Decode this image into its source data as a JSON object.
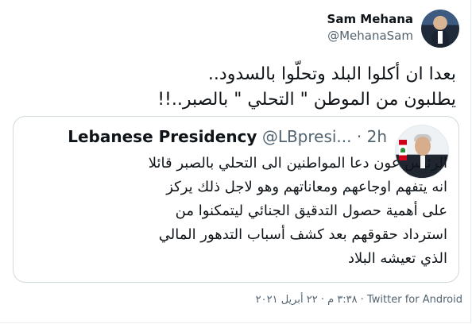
{
  "author": {
    "display_name": "Sam Mehana",
    "handle": "@MehanaSam"
  },
  "tweet": {
    "lines": [
      "بعدا ان أكلوا البلد وتحلّوا بالسدود..",
      "يطلبون من الموطن \" التحلي \" بالصبر..!!"
    ]
  },
  "quoted_tweet": {
    "display_name": "Lebanese Presidency",
    "handle": "@LBpresi...",
    "dot": "·",
    "time": "2h",
    "lines": [
      "الرئيس عون دعا المواطنين الى التحلي بالصبر قائلا",
      "انه يتفهم اوجاعهم ومعاناتهم وهو لاجل ذلك يركز",
      "على أهمية حصول التدقيق الجنائي ليتمكنوا من",
      "استرداد حقوقهم بعد كشف أسباب التدهور المالي",
      "الذي تعيشه البلاد"
    ]
  },
  "footer": {
    "source": "Twitter for Android",
    "separator": "·",
    "date_time": "٣:٣٨ م · ٢٢ أبريل ٢٠٢١"
  }
}
